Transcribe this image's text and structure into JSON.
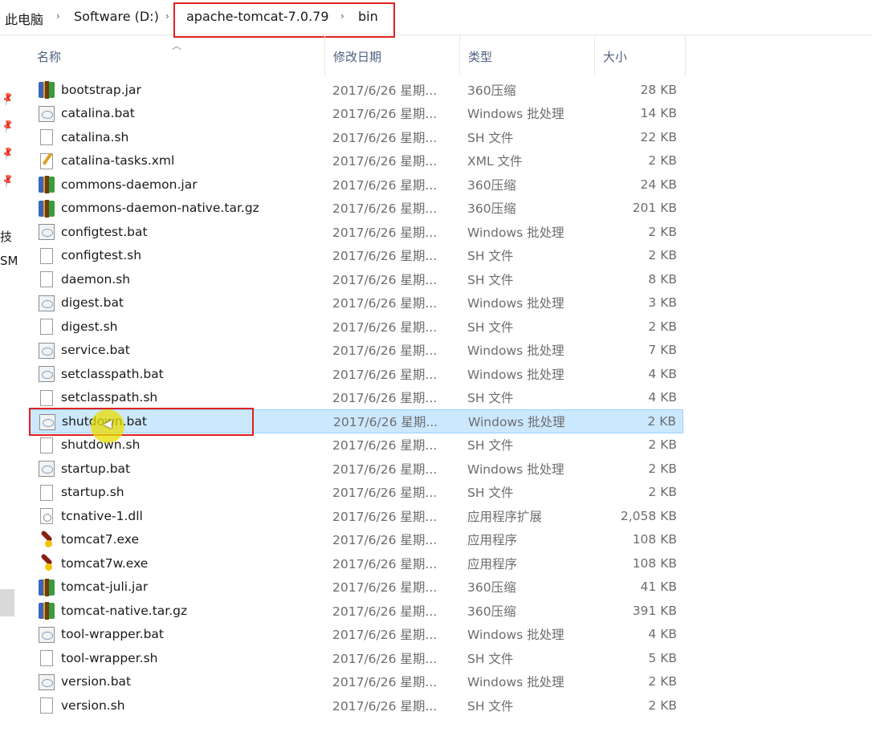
{
  "breadcrumb": {
    "items": [
      "此电脑",
      "Software (D:)",
      "apache-tomcat-7.0.79",
      "bin"
    ],
    "separator": "›"
  },
  "leftnav": {
    "labels": [
      "技",
      "SM"
    ]
  },
  "columns": {
    "name": "名称",
    "date": "修改日期",
    "type": "类型",
    "size": "大小"
  },
  "files": [
    {
      "name": "bootstrap.jar",
      "date": "2017/6/26 星期...",
      "type": "360压缩",
      "size": "28 KB",
      "icon": "jar"
    },
    {
      "name": "catalina.bat",
      "date": "2017/6/26 星期...",
      "type": "Windows 批处理",
      "size": "14 KB",
      "icon": "bat"
    },
    {
      "name": "catalina.sh",
      "date": "2017/6/26 星期...",
      "type": "SH 文件",
      "size": "22 KB",
      "icon": "doc"
    },
    {
      "name": "catalina-tasks.xml",
      "date": "2017/6/26 星期...",
      "type": "XML 文件",
      "size": "2 KB",
      "icon": "xml"
    },
    {
      "name": "commons-daemon.jar",
      "date": "2017/6/26 星期...",
      "type": "360压缩",
      "size": "24 KB",
      "icon": "jar"
    },
    {
      "name": "commons-daemon-native.tar.gz",
      "date": "2017/6/26 星期...",
      "type": "360压缩",
      "size": "201 KB",
      "icon": "jar"
    },
    {
      "name": "configtest.bat",
      "date": "2017/6/26 星期...",
      "type": "Windows 批处理",
      "size": "2 KB",
      "icon": "bat"
    },
    {
      "name": "configtest.sh",
      "date": "2017/6/26 星期...",
      "type": "SH 文件",
      "size": "2 KB",
      "icon": "doc"
    },
    {
      "name": "daemon.sh",
      "date": "2017/6/26 星期...",
      "type": "SH 文件",
      "size": "8 KB",
      "icon": "doc"
    },
    {
      "name": "digest.bat",
      "date": "2017/6/26 星期...",
      "type": "Windows 批处理",
      "size": "3 KB",
      "icon": "bat"
    },
    {
      "name": "digest.sh",
      "date": "2017/6/26 星期...",
      "type": "SH 文件",
      "size": "2 KB",
      "icon": "doc"
    },
    {
      "name": "service.bat",
      "date": "2017/6/26 星期...",
      "type": "Windows 批处理",
      "size": "7 KB",
      "icon": "bat"
    },
    {
      "name": "setclasspath.bat",
      "date": "2017/6/26 星期...",
      "type": "Windows 批处理",
      "size": "4 KB",
      "icon": "bat"
    },
    {
      "name": "setclasspath.sh",
      "date": "2017/6/26 星期...",
      "type": "SH 文件",
      "size": "4 KB",
      "icon": "doc"
    },
    {
      "name": "shutdown.bat",
      "date": "2017/6/26 星期...",
      "type": "Windows 批处理",
      "size": "2 KB",
      "icon": "bat",
      "selected": true
    },
    {
      "name": "shutdown.sh",
      "date": "2017/6/26 星期...",
      "type": "SH 文件",
      "size": "2 KB",
      "icon": "doc"
    },
    {
      "name": "startup.bat",
      "date": "2017/6/26 星期...",
      "type": "Windows 批处理",
      "size": "2 KB",
      "icon": "bat"
    },
    {
      "name": "startup.sh",
      "date": "2017/6/26 星期...",
      "type": "SH 文件",
      "size": "2 KB",
      "icon": "doc"
    },
    {
      "name": "tcnative-1.dll",
      "date": "2017/6/26 星期...",
      "type": "应用程序扩展",
      "size": "2,058 KB",
      "icon": "dll"
    },
    {
      "name": "tomcat7.exe",
      "date": "2017/6/26 星期...",
      "type": "应用程序",
      "size": "108 KB",
      "icon": "exe"
    },
    {
      "name": "tomcat7w.exe",
      "date": "2017/6/26 星期...",
      "type": "应用程序",
      "size": "108 KB",
      "icon": "exe"
    },
    {
      "name": "tomcat-juli.jar",
      "date": "2017/6/26 星期...",
      "type": "360压缩",
      "size": "41 KB",
      "icon": "jar"
    },
    {
      "name": "tomcat-native.tar.gz",
      "date": "2017/6/26 星期...",
      "type": "360压缩",
      "size": "391 KB",
      "icon": "jar"
    },
    {
      "name": "tool-wrapper.bat",
      "date": "2017/6/26 星期...",
      "type": "Windows 批处理",
      "size": "4 KB",
      "icon": "bat"
    },
    {
      "name": "tool-wrapper.sh",
      "date": "2017/6/26 星期...",
      "type": "SH 文件",
      "size": "5 KB",
      "icon": "doc"
    },
    {
      "name": "version.bat",
      "date": "2017/6/26 星期...",
      "type": "Windows 批处理",
      "size": "2 KB",
      "icon": "bat"
    },
    {
      "name": "version.sh",
      "date": "2017/6/26 星期...",
      "type": "SH 文件",
      "size": "2 KB",
      "icon": "doc"
    }
  ]
}
